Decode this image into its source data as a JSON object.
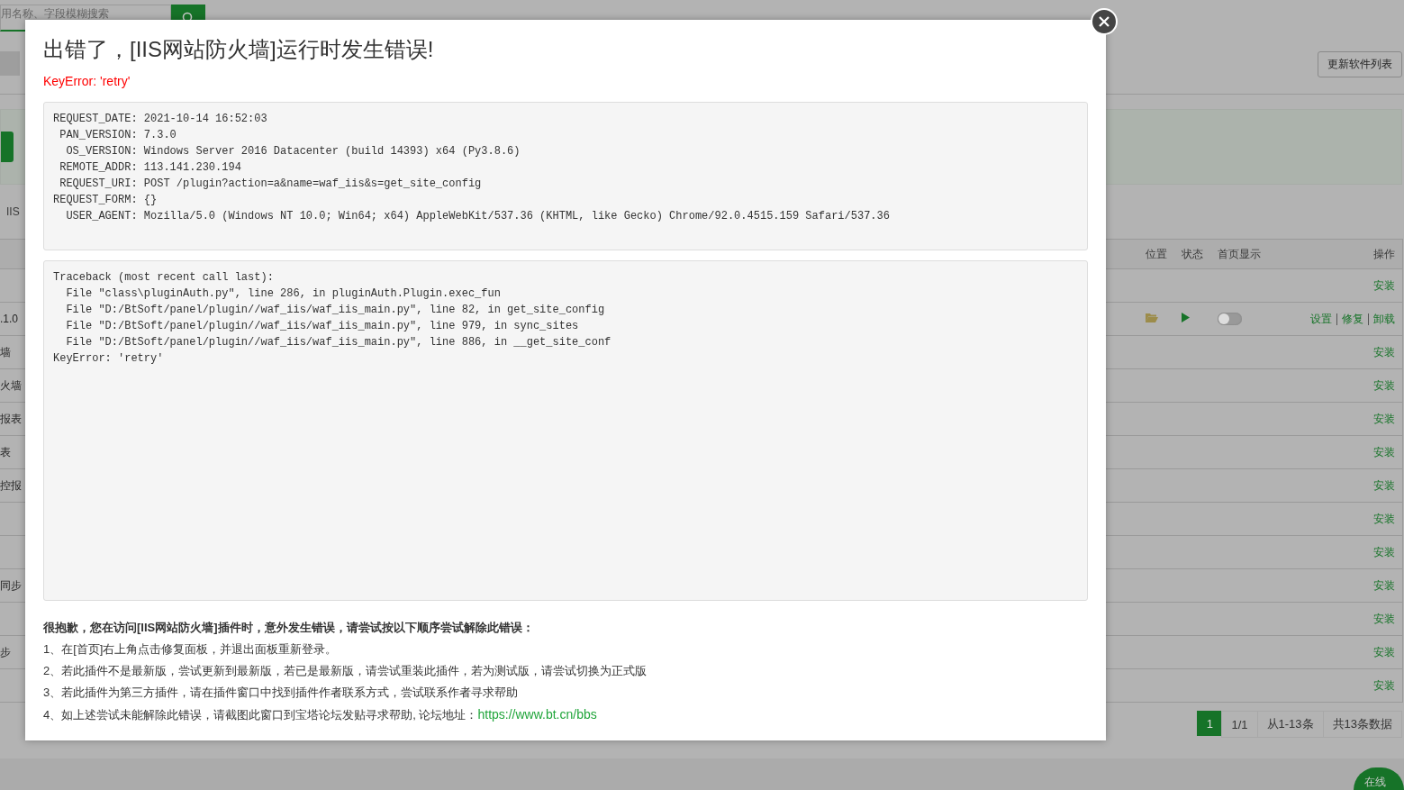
{
  "background_page": {
    "search": {
      "placeholder": "用名称、字段模糊搜索"
    },
    "update_button": "更新软件列表",
    "tab": "IIS",
    "table": {
      "columns": [
        "位置",
        "状态",
        "首页显示",
        "操作"
      ],
      "rows": [
        {
          "kind": "available",
          "action": "安装"
        },
        {
          "kind": "installed",
          "column_1": ".1.0",
          "toggle_on": false,
          "actions": [
            "设置",
            "修复",
            "卸载"
          ]
        },
        {
          "kind": "available",
          "column_1": "墙",
          "action": "安装"
        },
        {
          "kind": "available",
          "column_1": "火墙",
          "action": "安装"
        },
        {
          "kind": "available",
          "column_1": "报表",
          "action": "安装"
        },
        {
          "kind": "available",
          "column_1": "表",
          "action": "安装"
        },
        {
          "kind": "available",
          "column_1": "控报",
          "action": "安装"
        },
        {
          "kind": "available",
          "action": "安装"
        },
        {
          "kind": "available",
          "action": "安装"
        },
        {
          "kind": "available",
          "column_1": "同步",
          "action": "安装"
        },
        {
          "kind": "available",
          "action": "安装"
        },
        {
          "kind": "available",
          "column_1": "步",
          "action": "安装"
        },
        {
          "kind": "available",
          "action": "安装"
        }
      ]
    },
    "pagination": {
      "pages": [
        {
          "label": "1",
          "selected": true
        }
      ],
      "page_info": "1/1",
      "range": "从1-13条",
      "total": "共13条数据"
    },
    "chat_button": "在线"
  },
  "dialog": {
    "title": "出错了，[IIS网站防火墙]运行时发生错误!",
    "error": "KeyError: 'retry'",
    "request_info": [
      "REQUEST_DATE: 2021-10-14 16:52:03",
      " PAN_VERSION: 7.3.0",
      "  OS_VERSION: Windows Server 2016 Datacenter (build 14393) x64 (Py3.8.6)",
      " REMOTE_ADDR: 113.141.230.194",
      " REQUEST_URI: POST /plugin?action=a&name=waf_iis&s=get_site_config",
      "REQUEST_FORM: {}",
      "  USER_AGENT: Mozilla/5.0 (Windows NT 10.0; Win64; x64) AppleWebKit/537.36 (KHTML, like Gecko) Chrome/92.0.4515.159 Safari/537.36"
    ],
    "traceback": [
      "Traceback (most recent call last):",
      "  File \"class\\pluginAuth.py\", line 286, in pluginAuth.Plugin.exec_fun",
      "  File \"D:/BtSoft/panel/plugin//waf_iis/waf_iis_main.py\", line 82, in get_site_config",
      "  File \"D:/BtSoft/panel/plugin//waf_iis/waf_iis_main.py\", line 979, in sync_sites",
      "  File \"D:/BtSoft/panel/plugin//waf_iis/waf_iis_main.py\", line 886, in __get_site_conf",
      "KeyError: 'retry'"
    ],
    "help": {
      "heading": "很抱歉，您在访问[IIS网站防火墙]插件时，意外发生错误，请尝试按以下顺序尝试解除此错误：",
      "items": [
        {
          "text": "1、在[首页]右上角点击修复面板，并退出面板重新登录。"
        },
        {
          "text": "2、若此插件不是最新版，尝试更新到最新版，若已是最新版，请尝试重装此插件，若为测试版，请尝试切换为正式版"
        },
        {
          "text": "3、若此插件为第三方插件，请在插件窗口中找到插件作者联系方式，尝试联系作者寻求帮助"
        },
        {
          "text": "4、如上述尝试未能解除此错误，请截图此窗口到宝塔论坛发贴寻求帮助, 论坛地址：",
          "link": "https://www.bt.cn/bbs"
        }
      ]
    }
  }
}
